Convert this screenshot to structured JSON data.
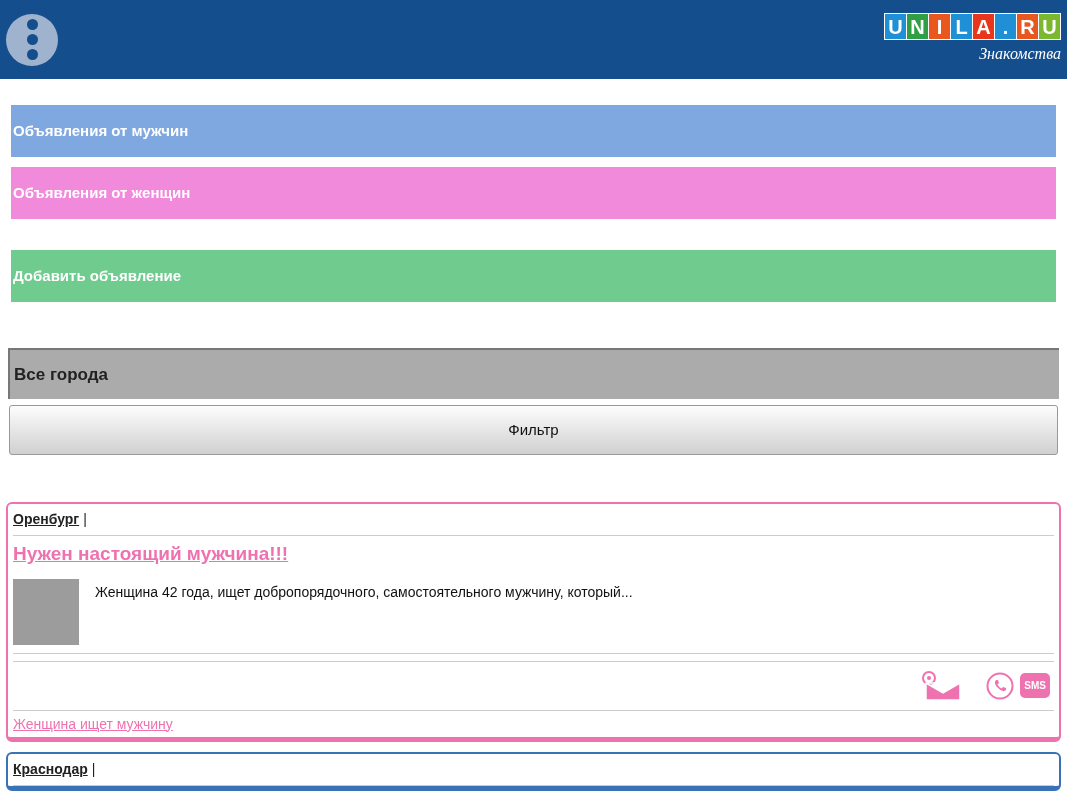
{
  "header": {
    "logo_letters": [
      {
        "text": "U",
        "color": "#1f8fd6"
      },
      {
        "text": "N",
        "color": "#2f9e44"
      },
      {
        "text": "I",
        "color": "#e8571d"
      },
      {
        "text": "L",
        "color": "#1f8fd6"
      },
      {
        "text": "A",
        "color": "#e8361d"
      },
      {
        "text": ".",
        "color": "#1f8fd6"
      },
      {
        "text": "R",
        "color": "#e8571d"
      },
      {
        "text": "U",
        "color": "#7cb82f"
      }
    ],
    "tagline": "Знакомства"
  },
  "nav": [
    {
      "label": "Объявления от мужчин",
      "color": "#80a8e0"
    },
    {
      "label": "Объявления от женщин",
      "color": "#f28adb"
    }
  ],
  "add_button": "Добавить объявление",
  "city_select": "Все города",
  "filter_button": "Фильтр",
  "ads": [
    {
      "color": "#ee72b0",
      "city": "Оренбург",
      "separator": "|",
      "title": "Нужен настоящий мужчина!!!",
      "text": "Женщина 42 года, ищет добропорядочного, самостоятельного мужчину, который...",
      "sms": "SMS",
      "category": "Женщина ищет мужчину"
    },
    {
      "color": "#3a72b8",
      "city": "Краснодар",
      "separator": "|"
    }
  ]
}
